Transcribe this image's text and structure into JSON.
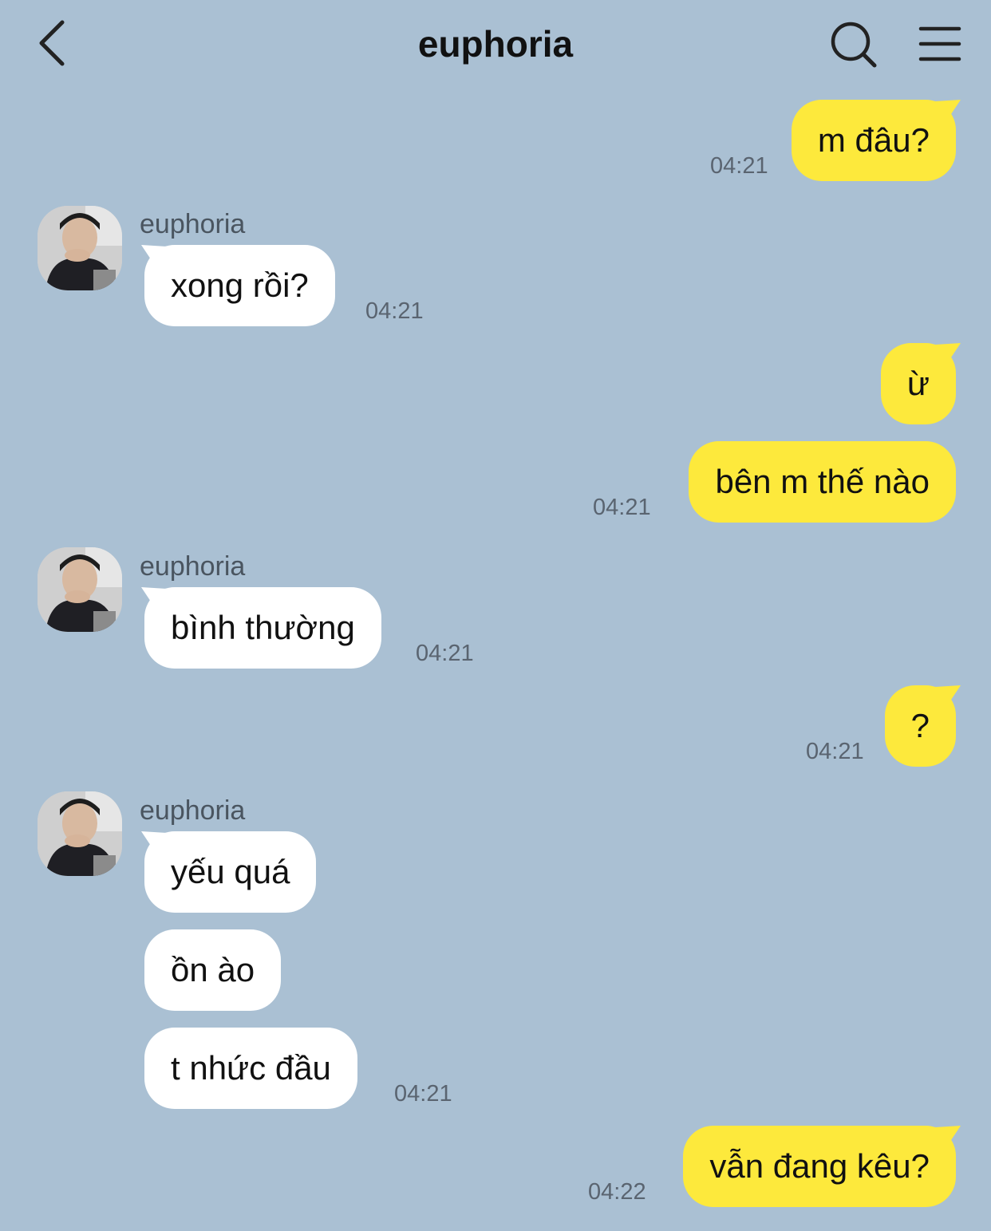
{
  "header": {
    "title": "euphoria"
  },
  "messages": {
    "m1": {
      "text": "m đâu?",
      "time": "04:21"
    },
    "t1": {
      "sender": "euphoria",
      "text": "xong rồi?",
      "time": "04:21"
    },
    "m2": {
      "text": "ừ"
    },
    "m3": {
      "text": "bên m thế nào",
      "time": "04:21"
    },
    "t2": {
      "sender": "euphoria",
      "text": "bình thường",
      "time": "04:21"
    },
    "m4": {
      "text": "?",
      "time": "04:21"
    },
    "t3": {
      "sender": "euphoria",
      "text": "yếu quá"
    },
    "t4": {
      "text": "ồn ào"
    },
    "t5": {
      "text": "t nhức đầu",
      "time": "04:21"
    },
    "m5": {
      "text": "vẫn đang kêu?",
      "time": "04:22"
    }
  },
  "colors": {
    "background": "#aac0d3",
    "my_bubble": "#fde93c",
    "their_bubble": "#ffffff"
  },
  "icons": {
    "back": "chevron-left-icon",
    "search": "search-icon",
    "menu": "hamburger-menu-icon"
  }
}
